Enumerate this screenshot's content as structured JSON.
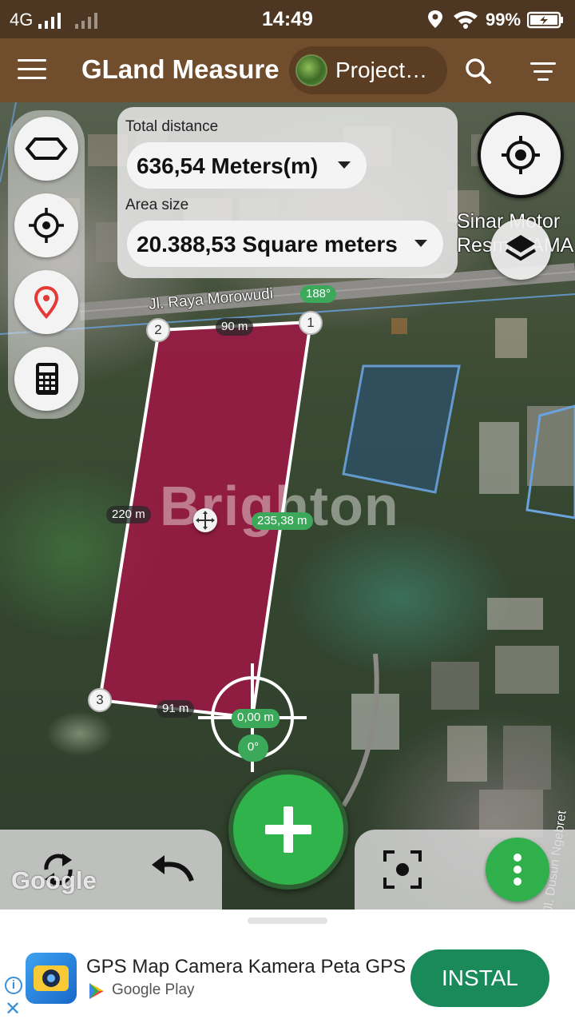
{
  "status_bar": {
    "network": "4G",
    "time": "14:49",
    "battery": "99%"
  },
  "app_bar": {
    "title": "GLand Measure",
    "project_label": "Project…"
  },
  "measurement": {
    "distance_label": "Total distance",
    "distance_value": "636,54 Meters(m)",
    "area_label": "Area size",
    "area_value": "20.388,53 Square meters"
  },
  "map": {
    "road_label": "Jl. Raya Morowudi",
    "poi_label_line1": "Sinar Motor",
    "poi_label_line2": "Resmi YAMA",
    "street_label": "Jl. Dusun Ngebret",
    "watermark": "Brighton",
    "attribution": "Google",
    "bearing_top": "188°",
    "cursor_distance": "0,00 m",
    "cursor_bearing": "0°",
    "vertices": [
      "1",
      "2",
      "3"
    ],
    "segment_labels": {
      "top": "90 m",
      "left": "220 m",
      "right": "235,38 m",
      "bottom": "91 m"
    },
    "polygon_color": "#a31446"
  },
  "ad": {
    "app_name": "GPS Map Camera Kamera Peta GPS",
    "store": "Google Play",
    "install_label": "INSTAL"
  },
  "colors": {
    "toolbar": "#704e2d",
    "fab": "#30b34a",
    "install": "#1b8a5b"
  }
}
